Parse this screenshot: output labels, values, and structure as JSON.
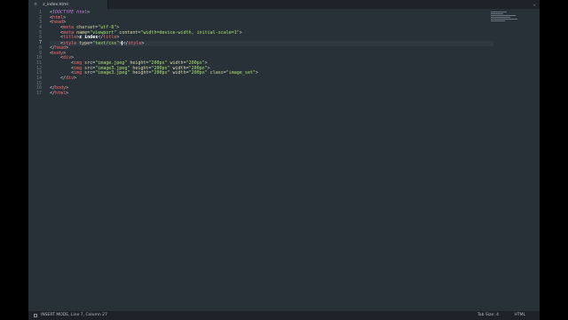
{
  "window": {
    "tab": {
      "title": "z_index.html",
      "close_symbol": "×"
    },
    "more_symbol": "⌄"
  },
  "editor": {
    "line_numbers": [
      "1",
      "2",
      "3",
      "4",
      "5",
      "6",
      "7",
      "8",
      "9",
      "10",
      "11",
      "12",
      "13",
      "14",
      "15",
      "16",
      "17"
    ],
    "active_line": 7,
    "lines": [
      [
        {
          "t": "<!",
          "c": "punc"
        },
        {
          "t": "DOCTYPE html",
          "c": "doc"
        },
        {
          "t": ">",
          "c": "punc"
        }
      ],
      [
        {
          "t": "<",
          "c": "punc"
        },
        {
          "t": "html",
          "c": "tag"
        },
        {
          "t": ">",
          "c": "punc"
        }
      ],
      [
        {
          "t": "<",
          "c": "punc"
        },
        {
          "t": "head",
          "c": "tag"
        },
        {
          "t": ">",
          "c": "punc"
        }
      ],
      [
        {
          "t": "    ",
          "c": "ws"
        },
        {
          "t": "<",
          "c": "punc"
        },
        {
          "t": "meta",
          "c": "tag"
        },
        {
          "t": " charset",
          "c": "attr"
        },
        {
          "t": "=",
          "c": "punc"
        },
        {
          "t": "\"utf-8\"",
          "c": "str"
        },
        {
          "t": ">",
          "c": "punc"
        }
      ],
      [
        {
          "t": "    ",
          "c": "ws"
        },
        {
          "t": "<",
          "c": "punc"
        },
        {
          "t": "meta",
          "c": "tag"
        },
        {
          "t": " name",
          "c": "attr"
        },
        {
          "t": "=",
          "c": "punc"
        },
        {
          "t": "\"viewport\"",
          "c": "str"
        },
        {
          "t": " content",
          "c": "attr"
        },
        {
          "t": "=",
          "c": "punc"
        },
        {
          "t": "\"width=device-width, initial-scale=1\"",
          "c": "str"
        },
        {
          "t": ">",
          "c": "punc"
        }
      ],
      [
        {
          "t": "    ",
          "c": "ws"
        },
        {
          "t": "<",
          "c": "punc"
        },
        {
          "t": "title",
          "c": "tag"
        },
        {
          "t": ">",
          "c": "punc"
        },
        {
          "t": "z index",
          "c": "text"
        },
        {
          "t": "</",
          "c": "punc"
        },
        {
          "t": "title",
          "c": "tag"
        },
        {
          "t": ">",
          "c": "punc"
        }
      ],
      [
        {
          "t": "    ",
          "c": "ws"
        },
        {
          "t": "<",
          "c": "punc"
        },
        {
          "t": "style",
          "c": "tag"
        },
        {
          "t": " type",
          "c": "attr"
        },
        {
          "t": "=",
          "c": "punc"
        },
        {
          "t": "\"text/css\"",
          "c": "str"
        },
        {
          "t": ">",
          "c": "punc"
        },
        {
          "t": "",
          "c": "caret"
        },
        {
          "t": "</",
          "c": "punc"
        },
        {
          "t": "style",
          "c": "tag"
        },
        {
          "t": ">",
          "c": "punc"
        }
      ],
      [
        {
          "t": "</",
          "c": "punc"
        },
        {
          "t": "head",
          "c": "tag"
        },
        {
          "t": ">",
          "c": "punc"
        }
      ],
      [
        {
          "t": "<",
          "c": "punc"
        },
        {
          "t": "body",
          "c": "tag"
        },
        {
          "t": ">",
          "c": "punc"
        }
      ],
      [
        {
          "t": "    ",
          "c": "ws"
        },
        {
          "t": "<",
          "c": "punc"
        },
        {
          "t": "div",
          "c": "tag"
        },
        {
          "t": ">",
          "c": "punc"
        }
      ],
      [
        {
          "t": "        ",
          "c": "ws"
        },
        {
          "t": "<",
          "c": "punc"
        },
        {
          "t": "img",
          "c": "tag"
        },
        {
          "t": " src",
          "c": "attr"
        },
        {
          "t": "=",
          "c": "punc"
        },
        {
          "t": "\"image.jpeg\"",
          "c": "str"
        },
        {
          "t": " height",
          "c": "attr"
        },
        {
          "t": "=",
          "c": "punc"
        },
        {
          "t": "\"200px\"",
          "c": "str"
        },
        {
          "t": " width",
          "c": "attr"
        },
        {
          "t": "=",
          "c": "punc"
        },
        {
          "t": "\"200px\"",
          "c": "str"
        },
        {
          "t": ">",
          "c": "punc"
        }
      ],
      [
        {
          "t": "        ",
          "c": "ws"
        },
        {
          "t": "<",
          "c": "punc"
        },
        {
          "t": "img",
          "c": "tag"
        },
        {
          "t": " src",
          "c": "attr"
        },
        {
          "t": "=",
          "c": "punc"
        },
        {
          "t": "\"image3.jpeg\"",
          "c": "str"
        },
        {
          "t": " height",
          "c": "attr"
        },
        {
          "t": "=",
          "c": "punc"
        },
        {
          "t": "\"200px\"",
          "c": "str"
        },
        {
          "t": " width",
          "c": "attr"
        },
        {
          "t": "=",
          "c": "punc"
        },
        {
          "t": "\"200px\"",
          "c": "str"
        },
        {
          "t": ">",
          "c": "punc"
        }
      ],
      [
        {
          "t": "        ",
          "c": "ws"
        },
        {
          "t": "<",
          "c": "punc"
        },
        {
          "t": "img",
          "c": "tag"
        },
        {
          "t": " src",
          "c": "attr"
        },
        {
          "t": "=",
          "c": "punc"
        },
        {
          "t": "\"image3.jpeg\"",
          "c": "str"
        },
        {
          "t": " height",
          "c": "attr"
        },
        {
          "t": "=",
          "c": "punc"
        },
        {
          "t": "\"200px\"",
          "c": "str"
        },
        {
          "t": " width",
          "c": "attr"
        },
        {
          "t": "=",
          "c": "punc"
        },
        {
          "t": "\"200px\"",
          "c": "str"
        },
        {
          "t": " class",
          "c": "attr"
        },
        {
          "t": "=",
          "c": "punc"
        },
        {
          "t": "\"image_set\"",
          "c": "str"
        },
        {
          "t": ">",
          "c": "punc"
        }
      ],
      [
        {
          "t": "    ",
          "c": "ws"
        },
        {
          "t": "</",
          "c": "punc"
        },
        {
          "t": "div",
          "c": "tag"
        },
        {
          "t": ">",
          "c": "punc"
        }
      ],
      [],
      [
        {
          "t": "</",
          "c": "punc"
        },
        {
          "t": "body",
          "c": "tag"
        },
        {
          "t": ">",
          "c": "punc"
        }
      ],
      [
        {
          "t": "</",
          "c": "punc"
        },
        {
          "t": "html",
          "c": "tag"
        },
        {
          "t": ">",
          "c": "punc"
        }
      ]
    ]
  },
  "status": {
    "mode": "INSERT MODE, Line 7, Column 27",
    "tab_size": "Tab Size: 4",
    "syntax": "HTML"
  },
  "colors": {
    "tag": "#ff6b6b",
    "attr": "#dcdcaa",
    "string": "#a7e36f",
    "doctype": "#c678dd",
    "text": "#ffffff",
    "background": "#283038"
  },
  "icons": {
    "status_icon": "status-panel-icon",
    "close_icon": "close-icon",
    "more_icon": "chevron-down-icon"
  }
}
